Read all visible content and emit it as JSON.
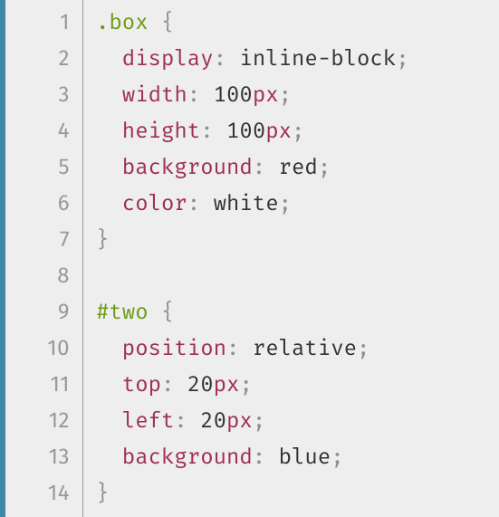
{
  "code": {
    "language": "css",
    "line_numbers": [
      "1",
      "2",
      "3",
      "4",
      "5",
      "6",
      "7",
      "8",
      "9",
      "10",
      "11",
      "12",
      "13",
      "14"
    ],
    "lines": [
      {
        "indent": 0,
        "tokens": [
          {
            "t": ".box",
            "c": "selector"
          },
          {
            "t": " ",
            "c": "value"
          },
          {
            "t": "{",
            "c": "punct"
          }
        ]
      },
      {
        "indent": 1,
        "tokens": [
          {
            "t": "display",
            "c": "prop"
          },
          {
            "t": ":",
            "c": "punct"
          },
          {
            "t": " ",
            "c": "value"
          },
          {
            "t": "inline-block",
            "c": "value"
          },
          {
            "t": ";",
            "c": "punct"
          }
        ]
      },
      {
        "indent": 1,
        "tokens": [
          {
            "t": "width",
            "c": "prop"
          },
          {
            "t": ":",
            "c": "punct"
          },
          {
            "t": " ",
            "c": "value"
          },
          {
            "t": "100",
            "c": "num"
          },
          {
            "t": "px",
            "c": "unit"
          },
          {
            "t": ";",
            "c": "punct"
          }
        ]
      },
      {
        "indent": 1,
        "tokens": [
          {
            "t": "height",
            "c": "prop"
          },
          {
            "t": ":",
            "c": "punct"
          },
          {
            "t": " ",
            "c": "value"
          },
          {
            "t": "100",
            "c": "num"
          },
          {
            "t": "px",
            "c": "unit"
          },
          {
            "t": ";",
            "c": "punct"
          }
        ]
      },
      {
        "indent": 1,
        "tokens": [
          {
            "t": "background",
            "c": "prop"
          },
          {
            "t": ":",
            "c": "punct"
          },
          {
            "t": " ",
            "c": "value"
          },
          {
            "t": "red",
            "c": "value"
          },
          {
            "t": ";",
            "c": "punct"
          }
        ]
      },
      {
        "indent": 1,
        "tokens": [
          {
            "t": "color",
            "c": "prop"
          },
          {
            "t": ":",
            "c": "punct"
          },
          {
            "t": " ",
            "c": "value"
          },
          {
            "t": "white",
            "c": "value"
          },
          {
            "t": ";",
            "c": "punct"
          }
        ]
      },
      {
        "indent": 0,
        "tokens": [
          {
            "t": "}",
            "c": "punct"
          }
        ]
      },
      {
        "indent": 0,
        "tokens": []
      },
      {
        "indent": 0,
        "tokens": [
          {
            "t": "#two",
            "c": "selector"
          },
          {
            "t": " ",
            "c": "value"
          },
          {
            "t": "{",
            "c": "punct"
          }
        ]
      },
      {
        "indent": 1,
        "tokens": [
          {
            "t": "position",
            "c": "prop"
          },
          {
            "t": ":",
            "c": "punct"
          },
          {
            "t": " ",
            "c": "value"
          },
          {
            "t": "relative",
            "c": "value"
          },
          {
            "t": ";",
            "c": "punct"
          }
        ]
      },
      {
        "indent": 1,
        "tokens": [
          {
            "t": "top",
            "c": "prop"
          },
          {
            "t": ":",
            "c": "punct"
          },
          {
            "t": " ",
            "c": "value"
          },
          {
            "t": "20",
            "c": "num"
          },
          {
            "t": "px",
            "c": "unit"
          },
          {
            "t": ";",
            "c": "punct"
          }
        ]
      },
      {
        "indent": 1,
        "tokens": [
          {
            "t": "left",
            "c": "prop"
          },
          {
            "t": ":",
            "c": "punct"
          },
          {
            "t": " ",
            "c": "value"
          },
          {
            "t": "20",
            "c": "num"
          },
          {
            "t": "px",
            "c": "unit"
          },
          {
            "t": ";",
            "c": "punct"
          }
        ]
      },
      {
        "indent": 1,
        "tokens": [
          {
            "t": "background",
            "c": "prop"
          },
          {
            "t": ":",
            "c": "punct"
          },
          {
            "t": " ",
            "c": "value"
          },
          {
            "t": "blue",
            "c": "value"
          },
          {
            "t": ";",
            "c": "punct"
          }
        ]
      },
      {
        "indent": 0,
        "tokens": [
          {
            "t": "}",
            "c": "punct"
          }
        ]
      }
    ]
  }
}
